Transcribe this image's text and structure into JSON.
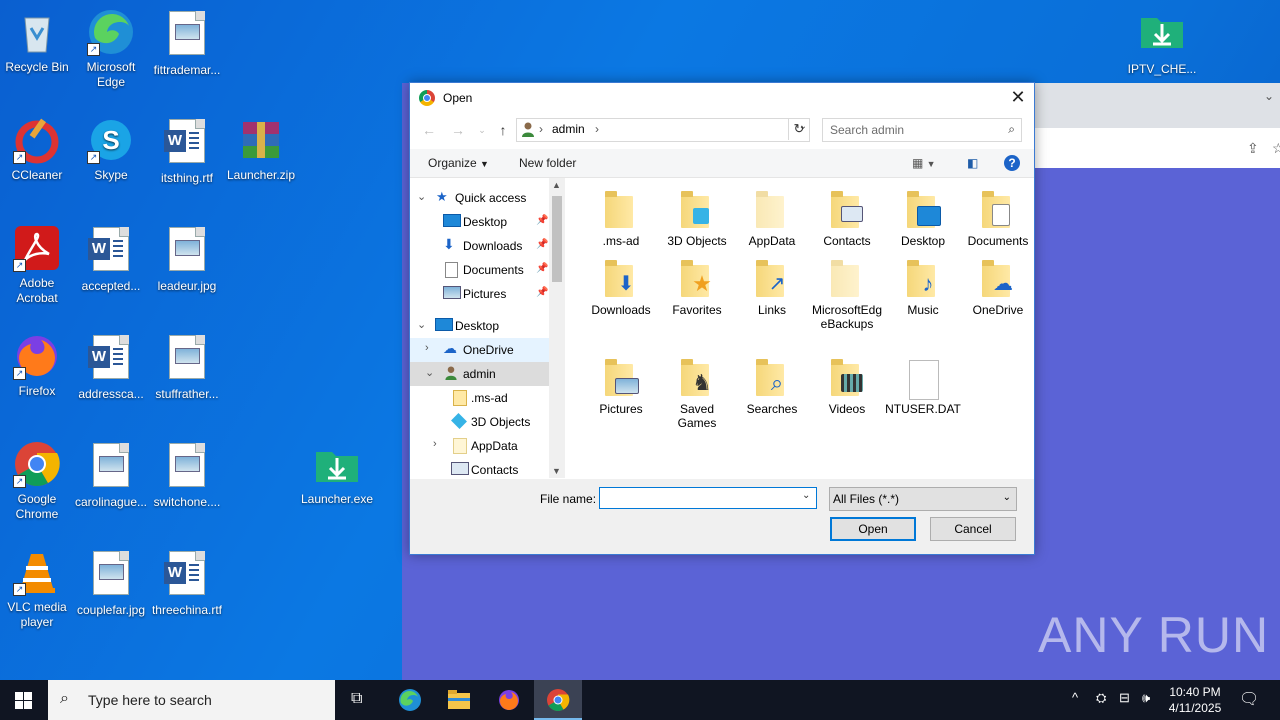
{
  "desktop": {
    "icons": [
      {
        "label": "Recycle Bin"
      },
      {
        "label": "Microsoft Edge"
      },
      {
        "label": "fittrademar..."
      },
      {
        "label": "CCleaner"
      },
      {
        "label": "Skype"
      },
      {
        "label": "itsthing.rtf"
      },
      {
        "label": "Launcher.zip"
      },
      {
        "label": "Adobe Acrobat"
      },
      {
        "label": "accepted..."
      },
      {
        "label": "leadeur.jpg"
      },
      {
        "label": "Firefox"
      },
      {
        "label": "addressca..."
      },
      {
        "label": "stuffrather..."
      },
      {
        "label": "Google Chrome"
      },
      {
        "label": "carolinague..."
      },
      {
        "label": "switchone...."
      },
      {
        "label": "Launcher.exe"
      },
      {
        "label": "VLC media player"
      },
      {
        "label": "couplefar.jpg"
      },
      {
        "label": "threechina.rtf"
      },
      {
        "label": "IPTV_CHE..."
      }
    ]
  },
  "dialog": {
    "title": "Open",
    "address": {
      "crumb": "admin"
    },
    "search_placeholder": "Search admin",
    "toolbar": {
      "organize": "Organize",
      "new_folder": "New folder"
    },
    "nav": [
      {
        "label": "Quick access"
      },
      {
        "label": "Desktop"
      },
      {
        "label": "Downloads"
      },
      {
        "label": "Documents"
      },
      {
        "label": "Pictures"
      },
      {
        "label": "Desktop"
      },
      {
        "label": "OneDrive"
      },
      {
        "label": "admin"
      },
      {
        "label": ".ms-ad"
      },
      {
        "label": "3D Objects"
      },
      {
        "label": "AppData"
      },
      {
        "label": "Contacts"
      }
    ],
    "items": [
      {
        "label": ".ms-ad"
      },
      {
        "label": "3D Objects"
      },
      {
        "label": "AppData"
      },
      {
        "label": "Contacts"
      },
      {
        "label": "Desktop"
      },
      {
        "label": "Documents"
      },
      {
        "label": "Downloads"
      },
      {
        "label": "Favorites"
      },
      {
        "label": "Links"
      },
      {
        "label": "MicrosoftEdgeBackups"
      },
      {
        "label": "Music"
      },
      {
        "label": "OneDrive"
      },
      {
        "label": "Pictures"
      },
      {
        "label": "Saved Games"
      },
      {
        "label": "Searches"
      },
      {
        "label": "Videos"
      },
      {
        "label": "NTUSER.DAT"
      }
    ],
    "file_name_label": "File name:",
    "file_name_value": "",
    "filter": "All Files (*.*)",
    "open_button": "Open",
    "cancel_button": "Cancel"
  },
  "taskbar": {
    "search_placeholder": "Type here to search",
    "time": "10:40 PM",
    "date": "4/11/2025"
  },
  "watermark": "ANY RUN"
}
